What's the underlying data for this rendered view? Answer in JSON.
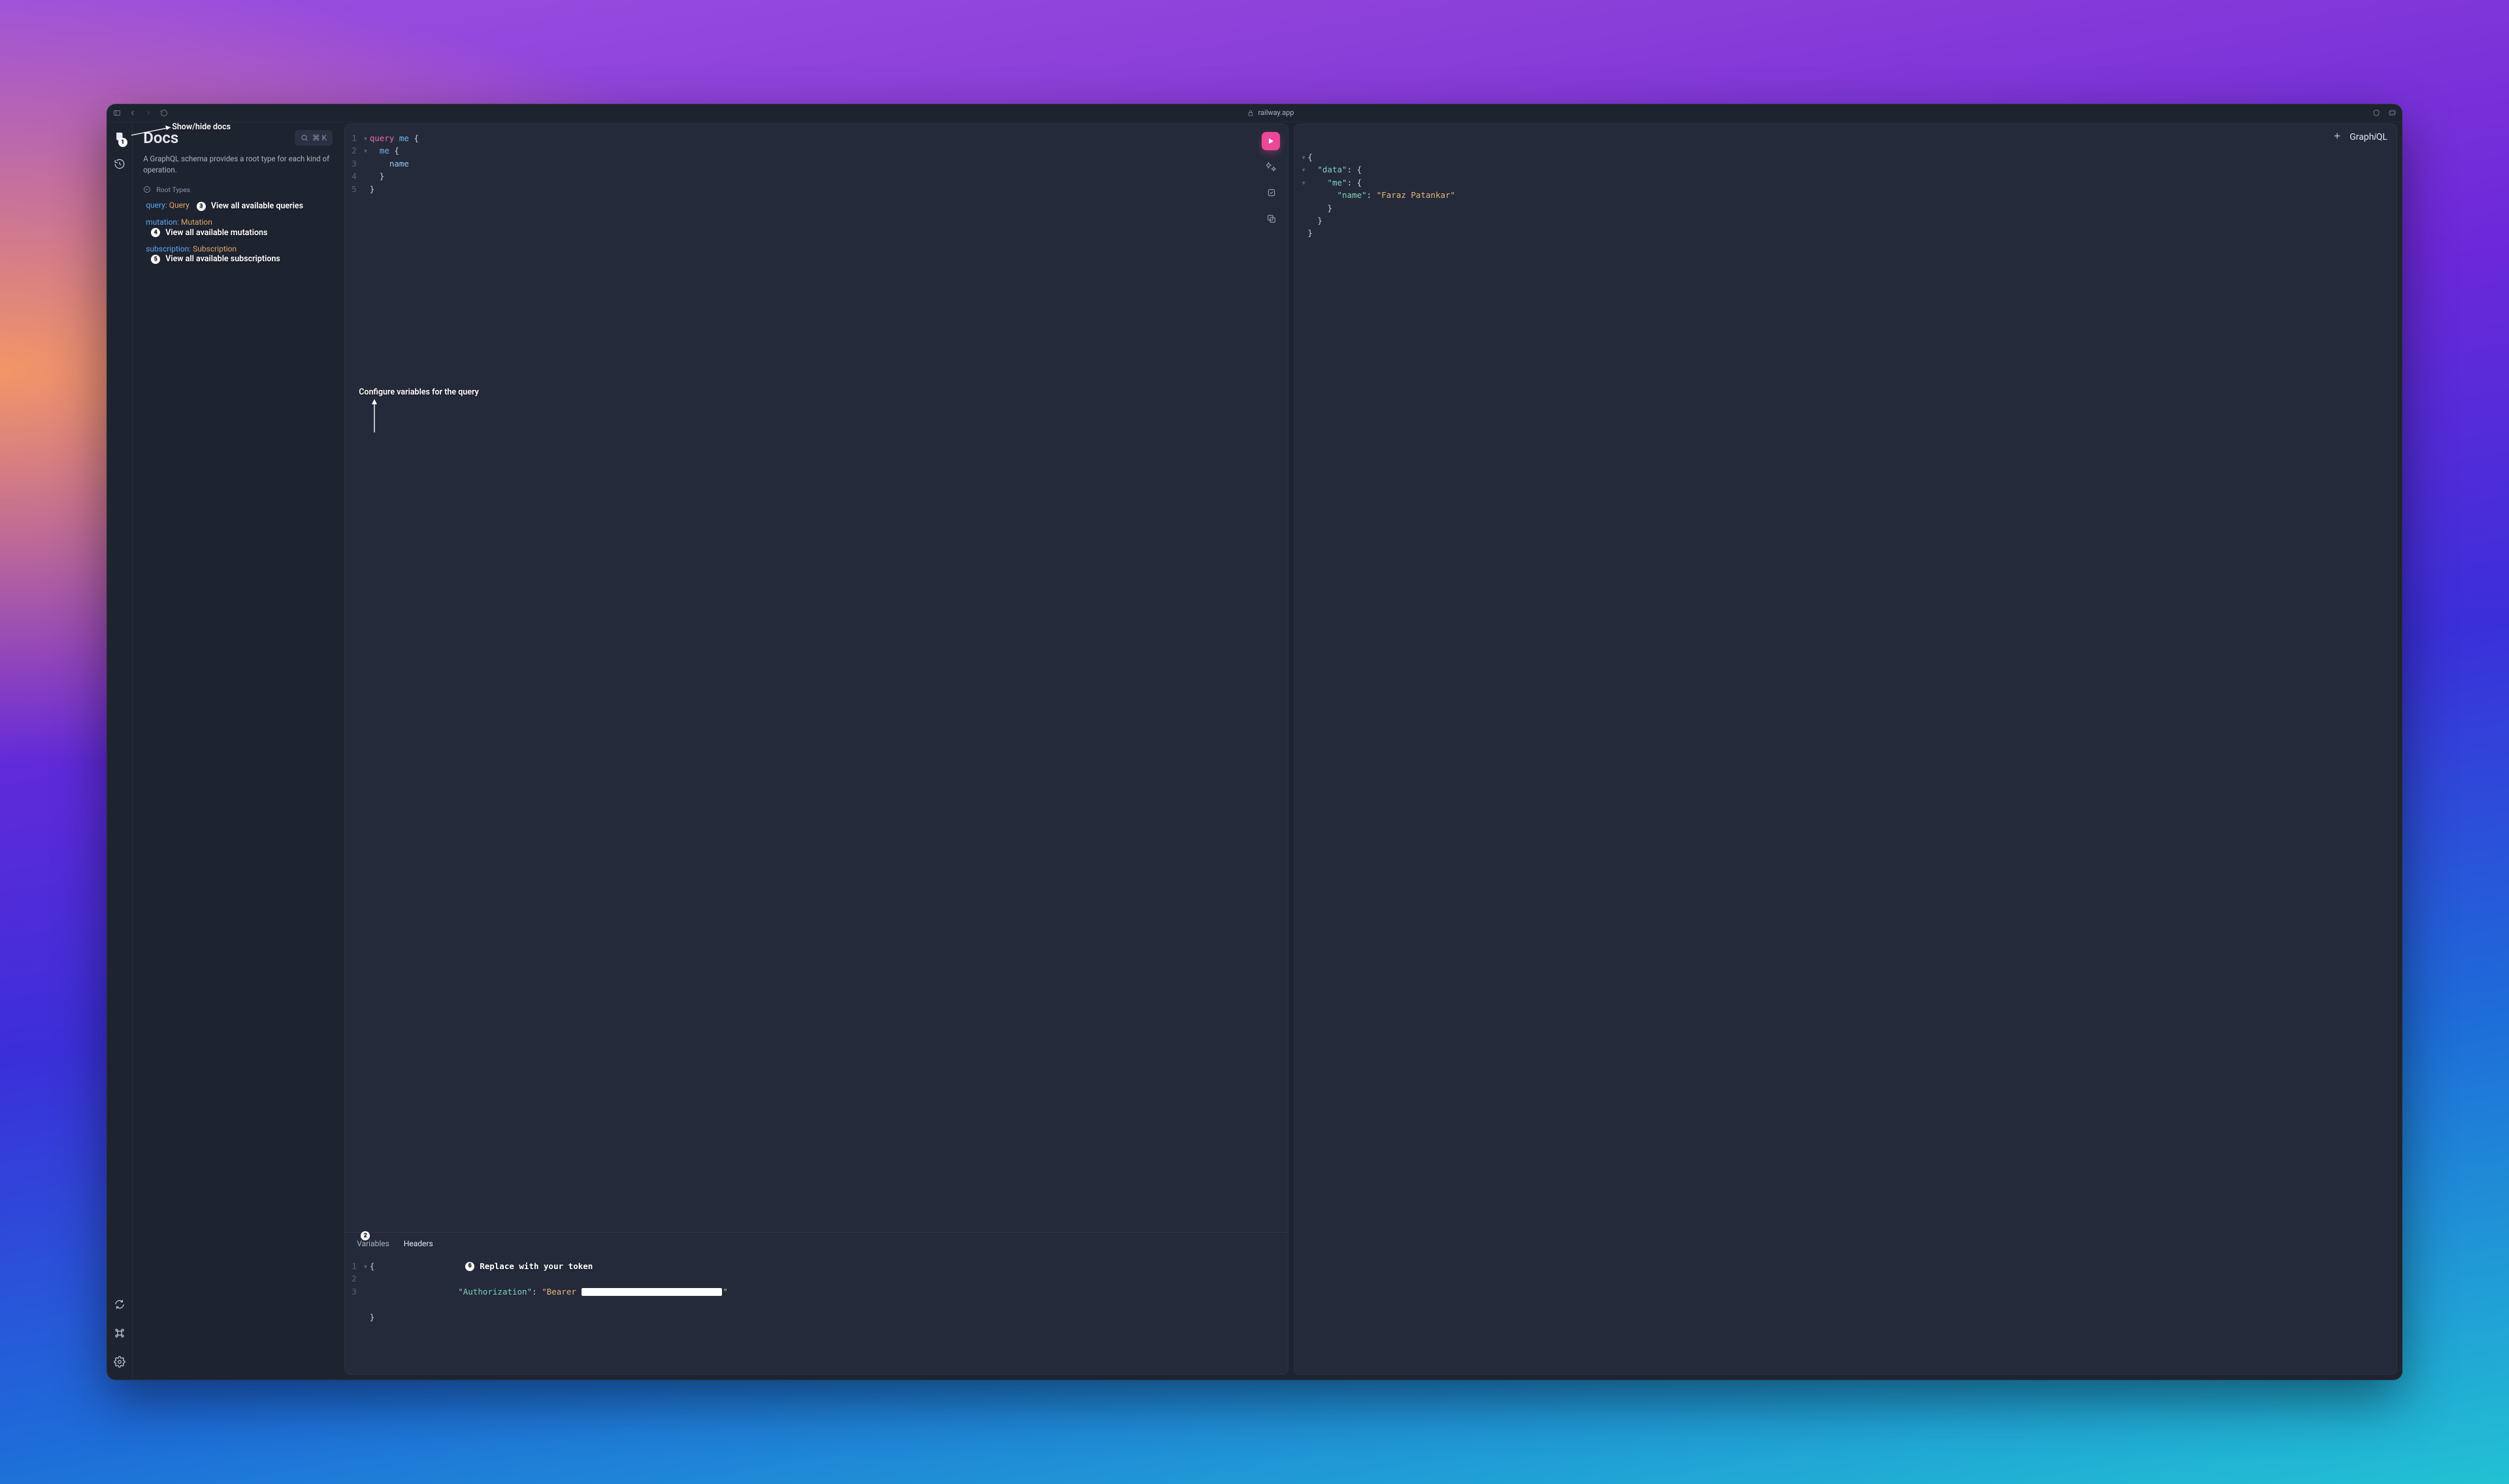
{
  "titlebar": {
    "domain": "railway.app"
  },
  "annotations": {
    "a1": {
      "num": "1",
      "text": "Show/hide docs"
    },
    "a2": {
      "num": "2",
      "text": "Configure variables for the query"
    },
    "a3": {
      "num": "3",
      "text": "View all available queries"
    },
    "a4": {
      "num": "4",
      "text": "View all available mutations"
    },
    "a5": {
      "num": "5",
      "text": "View all available subscriptions"
    },
    "a6": {
      "num": "6",
      "text": "Replace with your token"
    }
  },
  "docs": {
    "title": "Docs",
    "search_shortcut": "⌘ K",
    "description": "A GraphQL schema provides a root type for each kind of operation.",
    "root_types_label": "Root Types",
    "rows": {
      "query": {
        "key": "query",
        "colon": ": ",
        "type": "Query"
      },
      "mutation": {
        "key": "mutation",
        "colon": ": ",
        "type": "Mutation"
      },
      "subscription": {
        "key": "subscription",
        "colon": ": ",
        "type": "Subscription"
      }
    }
  },
  "query_editor": {
    "lines": {
      "l1": {
        "n": "1",
        "kw": "query",
        "sp1": " ",
        "id": "me",
        "sp2": " ",
        "brace": "{"
      },
      "l2": {
        "n": "2",
        "pad": "  ",
        "id": "me",
        "sp": " ",
        "brace": "{"
      },
      "l3": {
        "n": "3",
        "pad": "    ",
        "field": "name"
      },
      "l4": {
        "n": "4",
        "pad": "  ",
        "brace": "}"
      },
      "l5": {
        "n": "5",
        "brace": "}"
      }
    }
  },
  "vars": {
    "tabs": {
      "variables": "Variables",
      "headers": "Headers"
    },
    "lines": {
      "l1": {
        "n": "1",
        "brace": "{"
      },
      "l2": {
        "n": "2",
        "pad": "  ",
        "q1": "\"",
        "key": "Authorization",
        "q2": "\"",
        "colon": ": ",
        "q3": "\"",
        "bearer": "Bearer ",
        "q4": "\""
      },
      "l3": {
        "n": "3",
        "brace": "}"
      }
    }
  },
  "response": {
    "title": "Graph",
    "title_i": "i",
    "title2": "QL",
    "lines": {
      "l1": {
        "brace": "{"
      },
      "l2": {
        "pad": "  ",
        "q1": "\"",
        "key": "data",
        "q2": "\"",
        "colon": ": ",
        "brace": "{"
      },
      "l3": {
        "pad": "    ",
        "q1": "\"",
        "key": "me",
        "q2": "\"",
        "colon": ": ",
        "brace": "{"
      },
      "l4": {
        "pad": "      ",
        "q1": "\"",
        "key": "name",
        "q2": "\"",
        "colon": ": ",
        "q3": "\"",
        "val": "Faraz Patankar",
        "q4": "\""
      },
      "l5": {
        "pad": "    ",
        "brace": "}"
      },
      "l6": {
        "pad": "  ",
        "brace": "}"
      },
      "l7": {
        "brace": "}"
      }
    }
  }
}
